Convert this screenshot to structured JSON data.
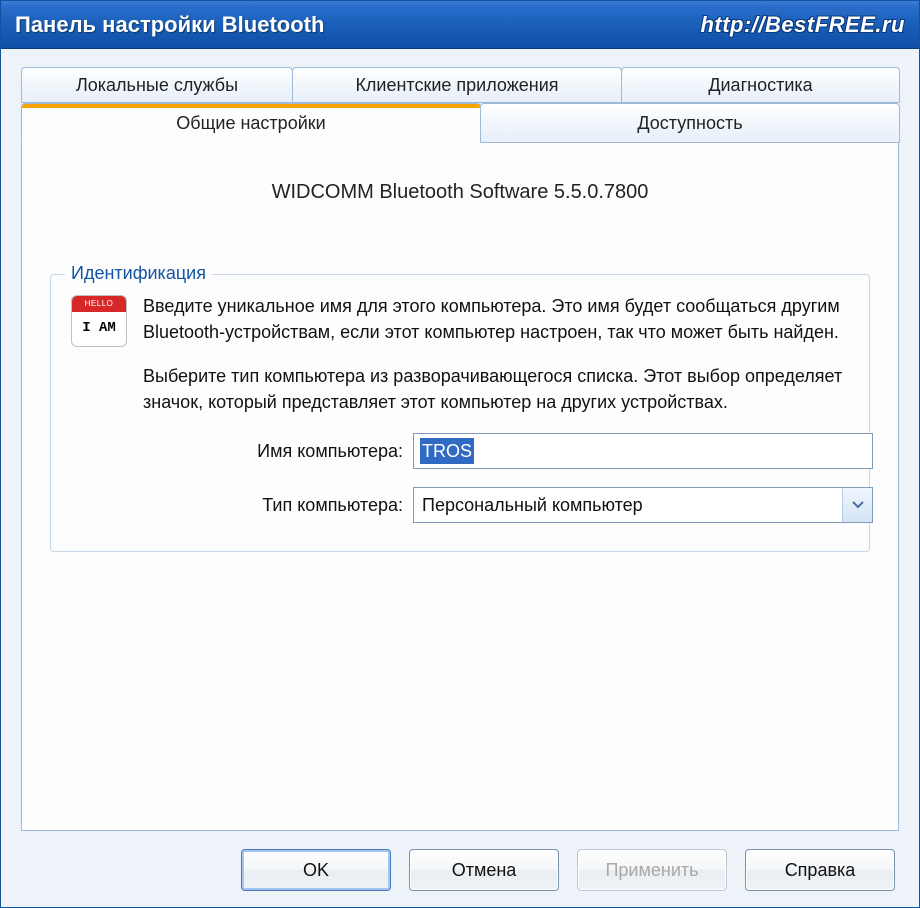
{
  "titlebar": {
    "title": "Панель настройки Bluetooth",
    "watermark": "http://BestFREE.ru"
  },
  "tabs": {
    "local_services": "Локальные службы",
    "client_apps": "Клиентские приложения",
    "diagnostics": "Диагностика",
    "general_settings": "Общие настройки",
    "availability": "Доступность"
  },
  "main": {
    "software_title": "WIDCOMM Bluetooth Software 5.5.0.7800",
    "group_title": "Идентификация",
    "desc1": "Введите уникальное имя для этого компьютера. Это имя будет сообщаться другим Bluetooth-устройствам, если этот компьютер настроен, так что может быть найден.",
    "desc2": "Выберите тип компьютера из разворачивающегося списка. Этот выбор определяет значок, который представляет этот компьютер на других устройствах.",
    "name_label": "Имя компьютера:",
    "name_value": "TROS",
    "type_label": "Тип компьютера:",
    "type_value": "Персональный компьютер",
    "icon_hello": "HELLO",
    "icon_iam": "I AM"
  },
  "buttons": {
    "ok": "OK",
    "cancel": "Отмена",
    "apply": "Применить",
    "help": "Справка"
  }
}
